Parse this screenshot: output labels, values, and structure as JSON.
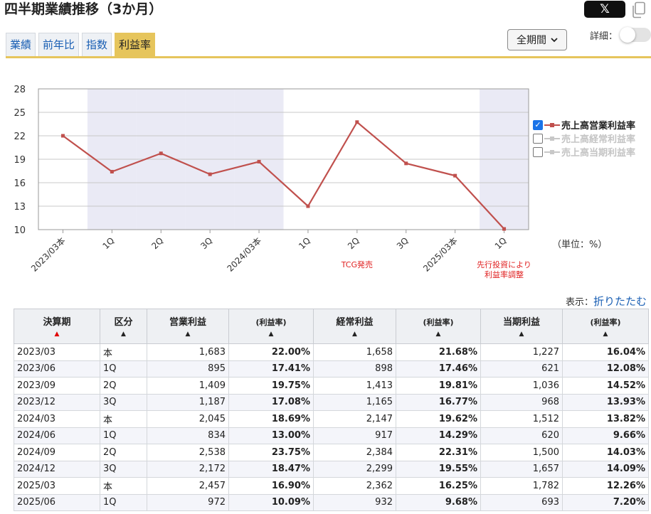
{
  "header": {
    "title": "四半期業績推移（3か月）",
    "x_label": "𝕏"
  },
  "tabs": [
    {
      "label": "業績",
      "active": false
    },
    {
      "label": "前年比",
      "active": false
    },
    {
      "label": "指数",
      "active": false
    },
    {
      "label": "利益率",
      "active": true
    }
  ],
  "controls": {
    "period_value": "全期間",
    "detail_label": "詳細："
  },
  "legend": [
    {
      "label": "売上高営業利益率",
      "checked": true,
      "color": "#c0504d"
    },
    {
      "label": "売上高経常利益率",
      "checked": false,
      "color": "#c8c8c8"
    },
    {
      "label": "売上高当期利益率",
      "checked": false,
      "color": "#c8c8c8"
    }
  ],
  "unit_label": "（単位：%）",
  "display": {
    "prefix": "表示：",
    "link": "折りたたむ"
  },
  "chart_data": {
    "type": "line",
    "categories": [
      "2023/03本",
      "1Q",
      "2Q",
      "3Q",
      "2024/03本",
      "1Q",
      "2Q",
      "3Q",
      "2025/03本",
      "1Q"
    ],
    "series": [
      {
        "name": "売上高営業利益率",
        "values": [
          22.0,
          17.41,
          19.75,
          17.08,
          18.69,
          13.0,
          23.75,
          18.47,
          16.9,
          10.09
        ],
        "color": "#c0504d"
      }
    ],
    "yticks": [
      10,
      13,
      16,
      19,
      22,
      25,
      28
    ],
    "ylim": [
      10,
      28
    ],
    "shaded_categories": [
      1,
      2,
      3,
      4,
      9
    ],
    "annotations": [
      {
        "index": 6,
        "lines": [
          "TCG発売"
        ],
        "color": "#e02020"
      },
      {
        "index": 9,
        "lines": [
          "先行投資により",
          "利益率調整"
        ],
        "color": "#e02020"
      }
    ]
  },
  "table": {
    "headers": [
      {
        "label": "決算期",
        "sort": "▲",
        "sort_active": true
      },
      {
        "label": "区分",
        "sort": "▲"
      },
      {
        "label": "営業利益",
        "sort": "▲"
      },
      {
        "label": "(利益率)",
        "sort": "▲",
        "small": true
      },
      {
        "label": "経常利益",
        "sort": "▲"
      },
      {
        "label": "(利益率)",
        "sort": "▲",
        "small": true
      },
      {
        "label": "当期利益",
        "sort": "▲"
      },
      {
        "label": "(利益率)",
        "sort": "▲",
        "small": true
      }
    ],
    "rows": [
      [
        "2023/03",
        "本",
        "1,683",
        "22.00%",
        "1,658",
        "21.68%",
        "1,227",
        "16.04%"
      ],
      [
        "2023/06",
        "1Q",
        "895",
        "17.41%",
        "898",
        "17.46%",
        "621",
        "12.08%"
      ],
      [
        "2023/09",
        "2Q",
        "1,409",
        "19.75%",
        "1,413",
        "19.81%",
        "1,036",
        "14.52%"
      ],
      [
        "2023/12",
        "3Q",
        "1,187",
        "17.08%",
        "1,165",
        "16.77%",
        "968",
        "13.93%"
      ],
      [
        "2024/03",
        "本",
        "2,045",
        "18.69%",
        "2,147",
        "19.62%",
        "1,512",
        "13.82%"
      ],
      [
        "2024/06",
        "1Q",
        "834",
        "13.00%",
        "917",
        "14.29%",
        "620",
        "9.66%"
      ],
      [
        "2024/09",
        "2Q",
        "2,538",
        "23.75%",
        "2,384",
        "22.31%",
        "1,500",
        "14.03%"
      ],
      [
        "2024/12",
        "3Q",
        "2,172",
        "18.47%",
        "2,299",
        "19.55%",
        "1,657",
        "14.09%"
      ],
      [
        "2025/03",
        "本",
        "2,457",
        "16.90%",
        "2,362",
        "16.25%",
        "1,782",
        "12.26%"
      ],
      [
        "2025/06",
        "1Q",
        "972",
        "10.09%",
        "932",
        "9.68%",
        "693",
        "7.20%"
      ]
    ]
  }
}
